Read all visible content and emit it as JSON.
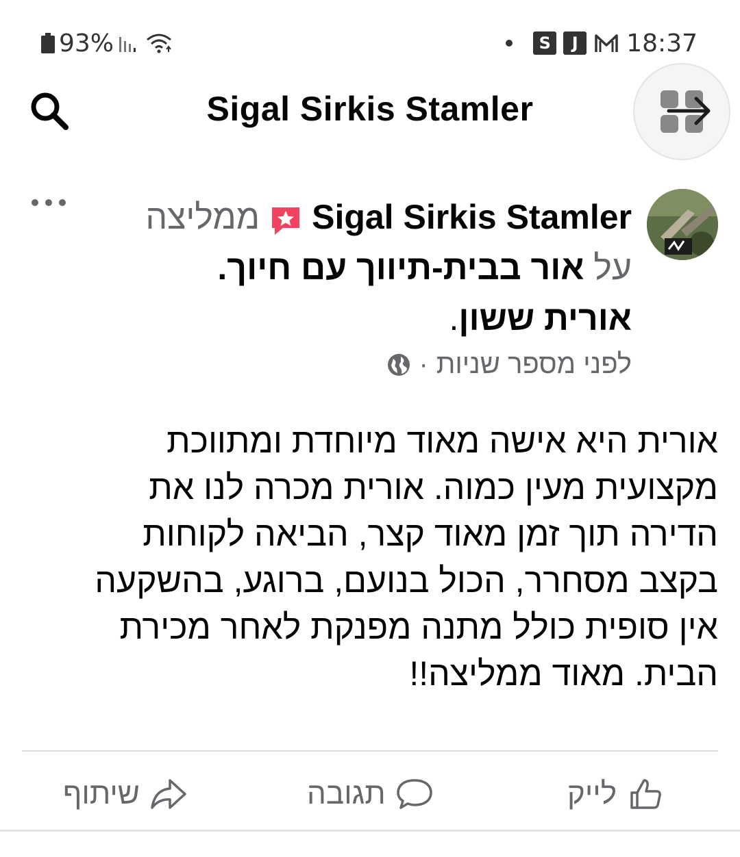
{
  "status_bar": {
    "battery": "93%",
    "time": "18:37",
    "notif_badges": [
      "S",
      "J"
    ]
  },
  "header": {
    "title": "Sigal Sirkis Stamler"
  },
  "post": {
    "author": "Sigal Sirkis Stamler",
    "recommends": "ממליצה",
    "on_label": "על",
    "page_name": "אור בבית-תיווך עם חיוך.",
    "agent_name": "אורית ששון",
    "agent_suffix": ".",
    "timestamp": "לפני מספר שניות",
    "separator": "·",
    "body_lines": [
      "אורית היא אישה מאוד מיוחדת ומתווכת",
      "מקצועית מעין כמוה. אורית מכרה לנו את",
      "הדירה תוך זמן מאוד קצר, הביאה לקוחות",
      "בקצב מסחרר, הכול בנועם, ברוגע, בהשקעה",
      "אין סופית כולל מתנה מפנקת לאחר מכירת",
      "הבית. מאוד ממליצה!!"
    ]
  },
  "actions": {
    "like": "לייק",
    "comment": "תגובה",
    "share": "שיתוף"
  },
  "colors": {
    "secondary_text": "#65676b",
    "recommend_badge": "#f3425f",
    "primary_text": "#050505"
  },
  "icons": [
    "search-icon",
    "switch-profile-icon",
    "more-icon",
    "recommend-icon",
    "globe-icon",
    "like-icon",
    "comment-icon",
    "share-icon"
  ]
}
